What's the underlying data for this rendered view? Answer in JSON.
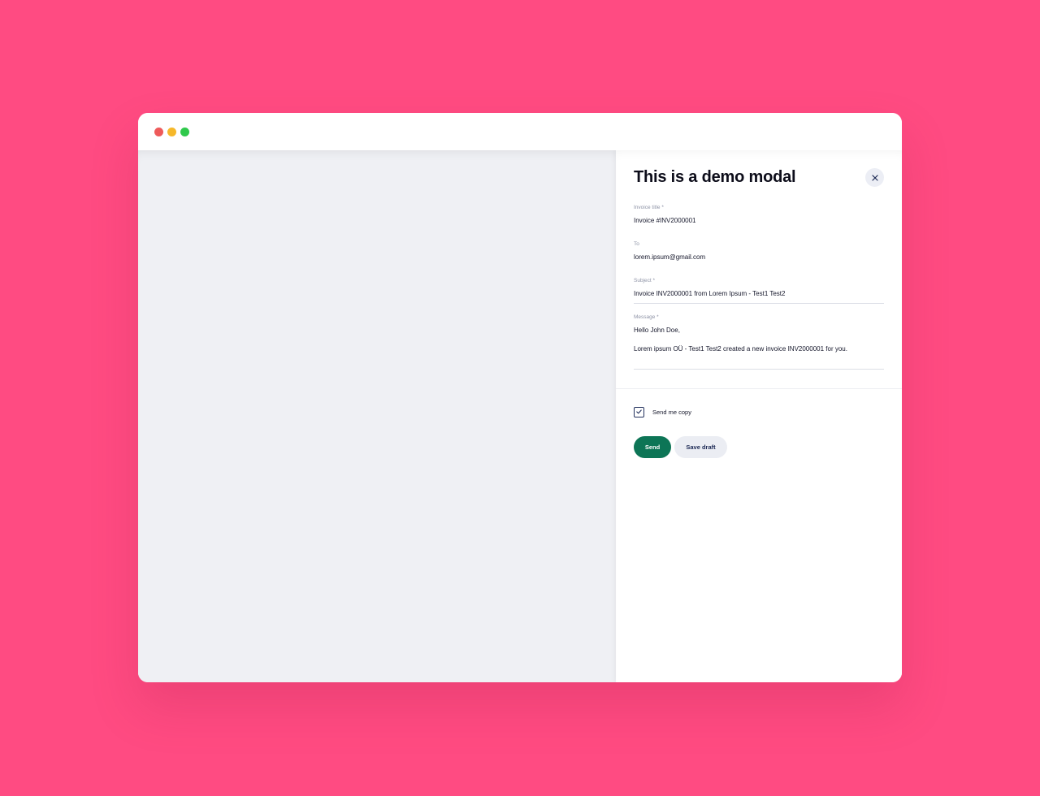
{
  "colors": {
    "background": "#ff4b82",
    "traffic_red": "#ee5a5a",
    "traffic_yellow": "#f6b82a",
    "traffic_green": "#2fc94b",
    "primary_button": "#0d7556",
    "secondary_button": "#ebedf3"
  },
  "modal": {
    "title": "This is a demo modal",
    "close_icon": "close-icon",
    "fields": {
      "invoice_title": {
        "label": "Invoice title *",
        "value": "Invoice #INV2000001"
      },
      "to": {
        "label": "To",
        "value": "lorem.ipsum@gmail.com"
      },
      "subject": {
        "label": "Subject *",
        "value": "Invoice INV2000001 from Lorem Ipsum - Test1 Test2"
      },
      "message": {
        "label": "Message *",
        "line1": "Hello John Doe,",
        "line2": "Lorem ipsum OÜ - Test1 Test2 created a new invoice INV2000001 for you."
      }
    },
    "send_copy": {
      "label": "Send me copy",
      "checked": true
    },
    "buttons": {
      "send": "Send",
      "save_draft": "Save draft"
    }
  }
}
